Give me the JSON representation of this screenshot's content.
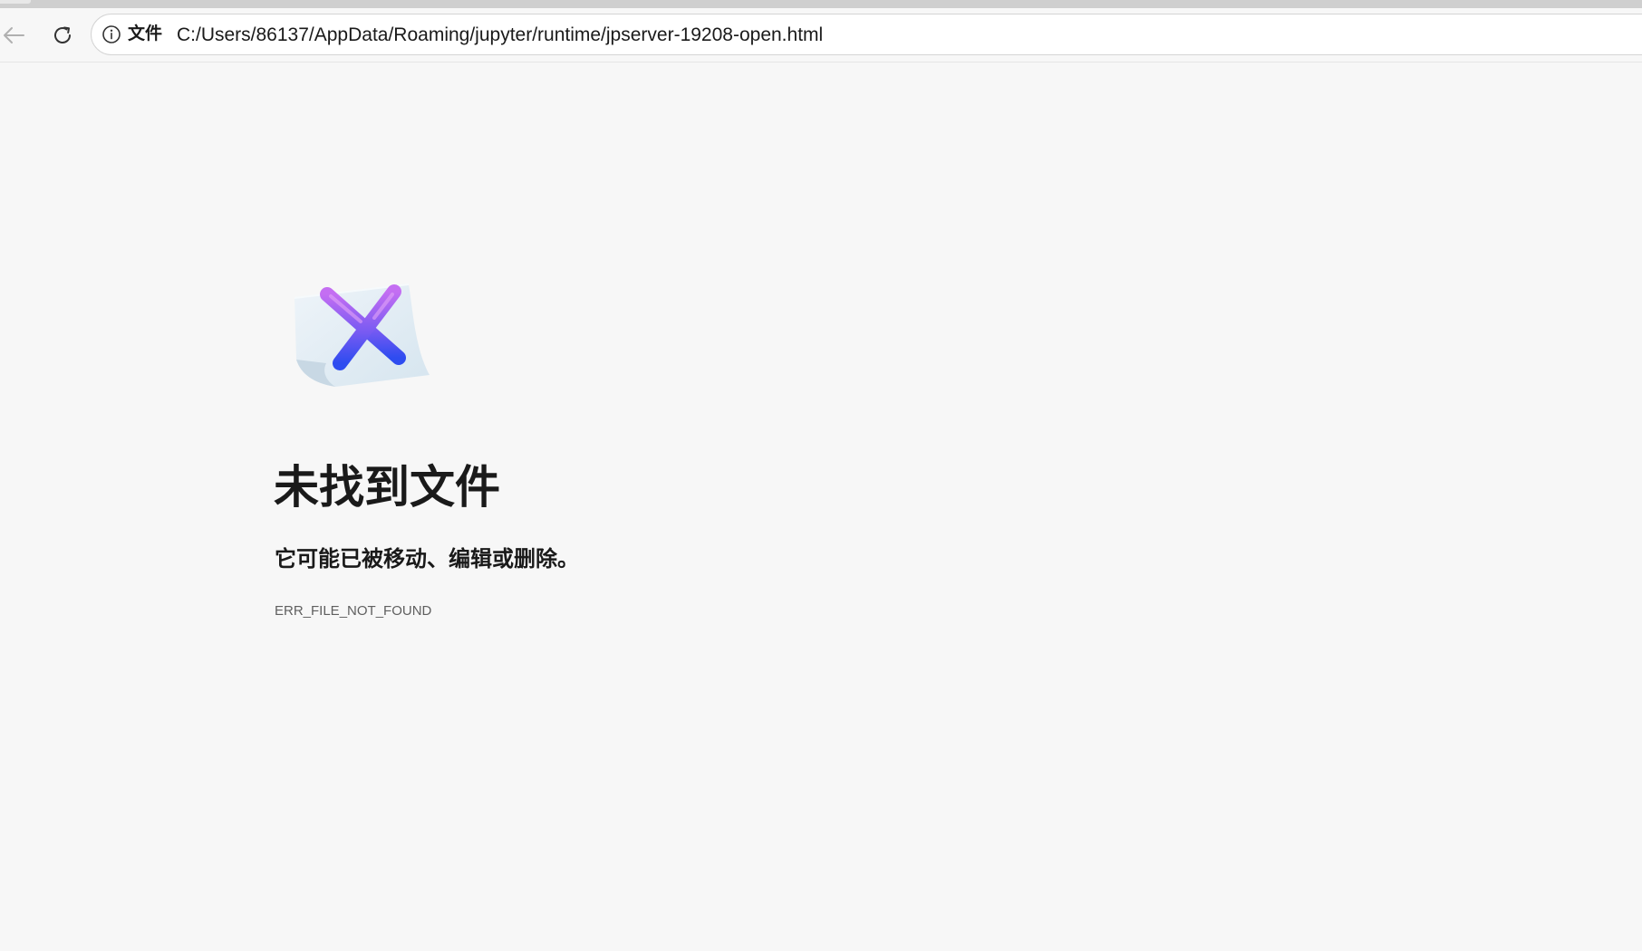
{
  "browser": {
    "address_bar": {
      "scheme_label": "文件",
      "url": "C:/Users/86137/AppData/Roaming/jupyter/runtime/jpserver-19208-open.html"
    },
    "icons": {
      "back": "arrow-left-icon",
      "reload": "reload-icon",
      "info": "info-icon"
    }
  },
  "error_page": {
    "illustration": "file-error-x-icon",
    "title": "未找到文件",
    "subtitle": "它可能已被移动、编辑或删除。",
    "code": "ERR_FILE_NOT_FOUND"
  },
  "colors": {
    "page_background": "#f7f7f7",
    "x_gradient_top": "#b65cf0",
    "x_gradient_bottom": "#2f4df0",
    "paper": "#e3eef6"
  }
}
